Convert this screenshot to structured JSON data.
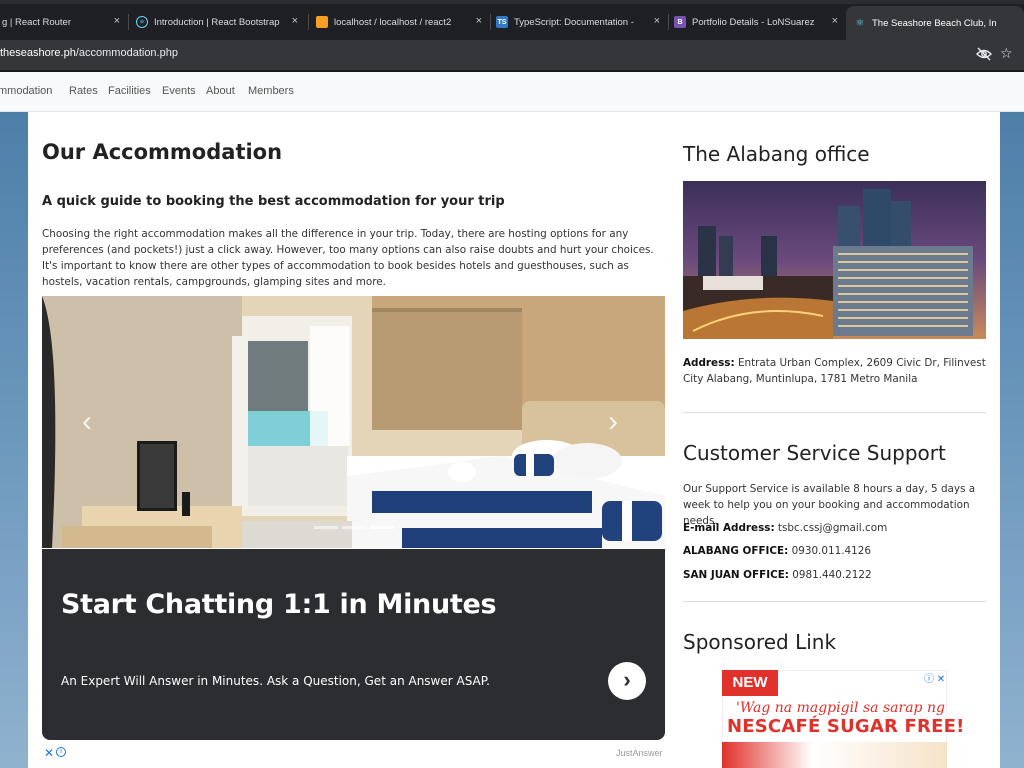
{
  "browser": {
    "tabs": [
      {
        "title": "g | React Router",
        "favicon": "react-router-icon",
        "active": false
      },
      {
        "title": "Introduction | React Bootstrap",
        "favicon": "react-icon",
        "active": false
      },
      {
        "title": "localhost / localhost / react2",
        "favicon": "phpmyadmin-icon",
        "active": false
      },
      {
        "title": "TypeScript: Documentation -",
        "favicon": "typescript-icon",
        "active": false
      },
      {
        "title": "Portfolio Details - LoNSuarez",
        "favicon": "bootstrap-icon",
        "active": false
      },
      {
        "title": "The Seashore Beach Club, Inc",
        "favicon": "react-icon",
        "active": true
      }
    ],
    "tab_close_glyph": "×",
    "url_host": "theseashore.ph",
    "url_path": "/accommodation.php",
    "star_glyph": "☆"
  },
  "nav": {
    "items": [
      "mmodation",
      "Rates",
      "Facilities",
      "Events",
      "About",
      "Members"
    ]
  },
  "main": {
    "title": "Our Accommodation",
    "subtitle": "A quick guide to booking the best accommodation for your trip",
    "intro": "Choosing the right accommodation makes all the difference in your trip. Today, there are hosting options for any preferences (and pockets!) just a click away. However, too many options can also raise doubts and hurt your choices. It's important to know there are other types of accommodation to book besides hotels and guesthouses, such as hostels, vacation rentals, campgrounds, glamping sites and more.",
    "carousel": {
      "prev_glyph": "‹",
      "next_glyph": "›",
      "slides": 3,
      "active_slide": 3
    }
  },
  "ad": {
    "title": "Start Chatting 1:1 in Minutes",
    "subtitle": "An Expert Will Answer in Minutes. Ask a Question, Get an Answer ASAP.",
    "button_glyph": "›",
    "close_glyph": "✕",
    "info_glyph": "i",
    "brand": "JustAnswer"
  },
  "sidebar": {
    "office_title": "The Alabang office",
    "address_label": "Address:",
    "address_value": "Entrata Urban Complex, 2609 Civic Dr, Filinvest City Alabang, Muntinlupa, 1781 Metro Manila",
    "support_title": "Customer Service Support",
    "support_text": "Our Support Service is available 8 hours a day, 5 days a week to help you on your booking and accommodation needs.",
    "email_label": "E-mail Address:",
    "email_value": "tsbc.cssj@gmail.com",
    "alabang_label": "ALABANG OFFICE:",
    "alabang_value": "0930.011.4126",
    "sanjuan_label": "SAN JUAN OFFICE:",
    "sanjuan_value": "0981.440.2122",
    "sponsored_title": "Sponsored Link",
    "sponsored_ad": {
      "badge": "NEW",
      "line1": "'Wag na magpigil sa sarap ng",
      "line2": "NESCAFÉ SUGAR FREE!",
      "adchoices_glyph": "ⓘ ✕"
    }
  },
  "colors": {
    "browser_dark": "#202124",
    "tab_active": "#35363a",
    "page_blue": "#4d7fa8",
    "ad_dark": "#2b2d31",
    "nescafe_red": "#e0312b"
  }
}
